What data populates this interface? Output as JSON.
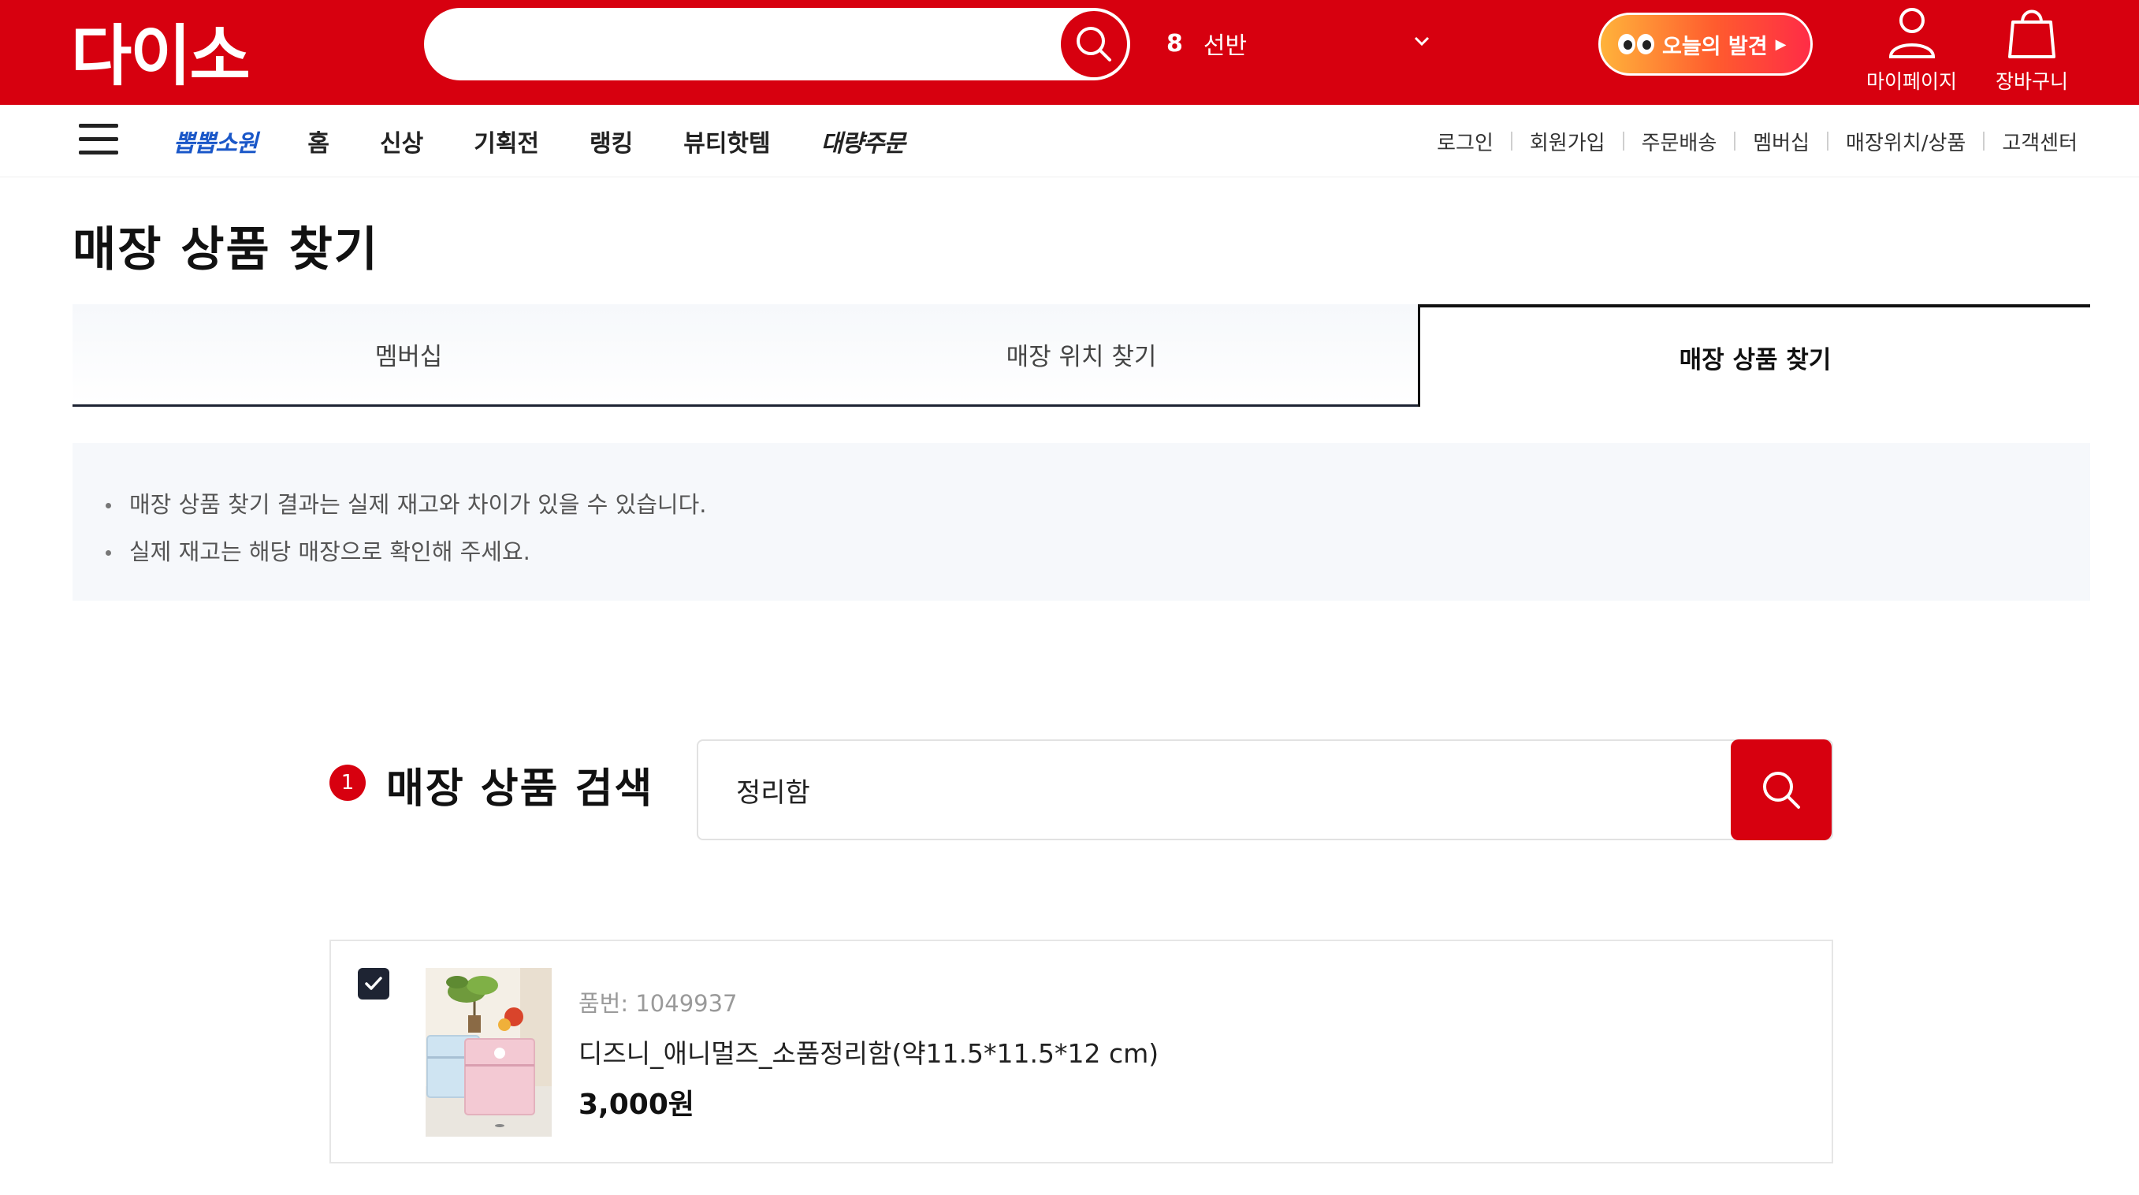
{
  "header": {
    "logo": "다이소",
    "search_placeholder": "",
    "trend_rank": "8",
    "trend_word": "선반",
    "discover_label": "오늘의 발견",
    "mypage_label": "마이페이지",
    "cart_label": "장바구니",
    "brand_color": "#d7000f"
  },
  "nav": {
    "items": [
      "뽑뽑소원",
      "홈",
      "신상",
      "기획전",
      "랭킹",
      "뷰티핫템",
      "대량주문"
    ],
    "util": [
      "로그인",
      "회원가입",
      "주문배송",
      "멤버십",
      "매장위치/상품",
      "고객센터"
    ]
  },
  "page": {
    "title": "매장 상품 찾기",
    "tabs": [
      {
        "label": "멤버십",
        "active": false
      },
      {
        "label": "매장 위치 찾기",
        "active": false
      },
      {
        "label": "매장 상품 찾기",
        "active": true
      }
    ],
    "notices": [
      "매장 상품 찾기 결과는 실제 재고와 차이가 있을 수 있습니다.",
      "실제 재고는 해당 매장으로 확인해 주세요."
    ]
  },
  "product_search": {
    "step": "1",
    "title": "매장 상품 검색",
    "value": "정리함"
  },
  "result": {
    "checked": true,
    "code": "품번: 1049937",
    "name": "디즈니_애니멀즈_소품정리함(약11.5*11.5*12 cm)",
    "price": "3,000원"
  }
}
